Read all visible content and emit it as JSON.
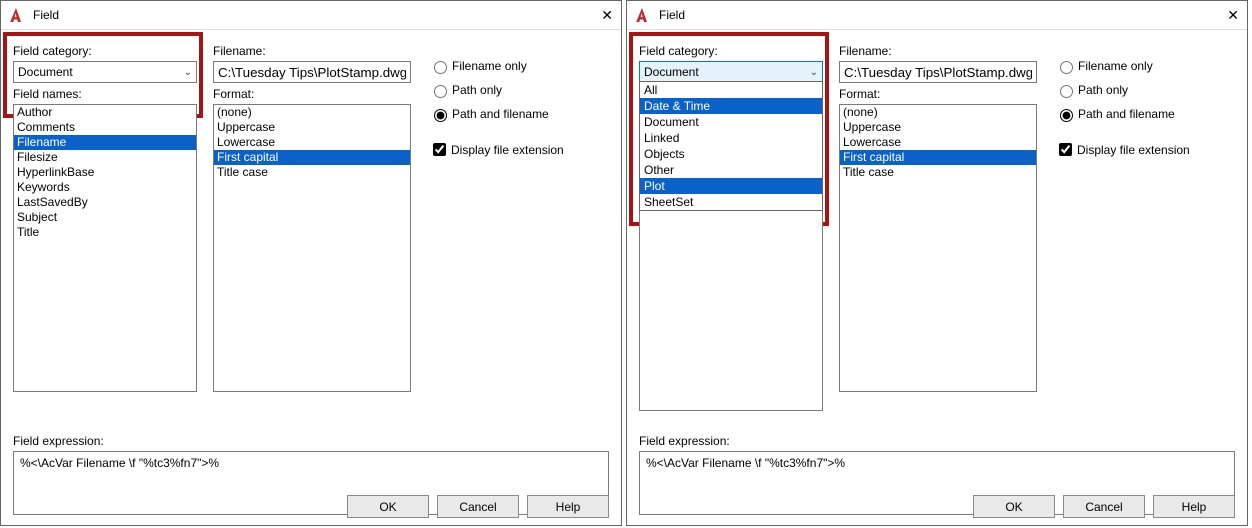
{
  "title": "Field",
  "left": {
    "fcat_label": "Field category:",
    "fcat_value": "Document",
    "fnames_label": "Field names:",
    "fnames": [
      {
        "label": "Author",
        "sel": false
      },
      {
        "label": "Comments",
        "sel": false
      },
      {
        "label": "Filename",
        "sel": true
      },
      {
        "label": "Filesize",
        "sel": false
      },
      {
        "label": "HyperlinkBase",
        "sel": false
      },
      {
        "label": "Keywords",
        "sel": false
      },
      {
        "label": "LastSavedBy",
        "sel": false
      },
      {
        "label": "Subject",
        "sel": false
      },
      {
        "label": "Title",
        "sel": false
      }
    ],
    "filename_label": "Filename:",
    "filename_value": "C:\\Tuesday Tips\\PlotStamp.dwg",
    "format_label": "Format:",
    "formats": [
      {
        "label": "(none)",
        "sel": false
      },
      {
        "label": "Uppercase",
        "sel": false
      },
      {
        "label": "Lowercase",
        "sel": false
      },
      {
        "label": "First capital",
        "sel": true
      },
      {
        "label": "Title case",
        "sel": false
      }
    ],
    "r1": "Filename only",
    "r2": "Path only",
    "r3": "Path and filename",
    "chk": "Display file extension",
    "fexpr_label": "Field expression:",
    "fexpr": "%<\\AcVar Filename \\f \"%tc3%fn7\">%"
  },
  "right": {
    "dropdown": [
      {
        "label": "All",
        "sel": false
      },
      {
        "label": "Date & Time",
        "sel": true
      },
      {
        "label": "Document",
        "sel": false
      },
      {
        "label": "Linked",
        "sel": false
      },
      {
        "label": "Objects",
        "sel": false
      },
      {
        "label": "Other",
        "sel": false
      },
      {
        "label": "Plot",
        "sel": true
      },
      {
        "label": "SheetSet",
        "sel": false
      }
    ]
  },
  "btn_ok": "OK",
  "btn_cancel": "Cancel",
  "btn_help": "Help"
}
